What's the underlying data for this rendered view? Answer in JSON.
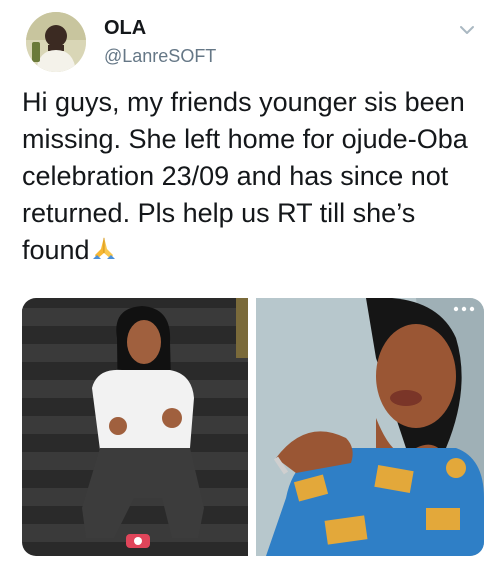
{
  "tweet": {
    "author": {
      "display_name": "OLA",
      "handle": "@LanreSOFT",
      "avatar_icon": "profile-photo"
    },
    "text": "Hi guys, my friends younger sis been missing. She left home for ojude-Oba celebration 23/09 and has since not returned. Pls help us RT till she’s found",
    "emoji": "folded-hands-emoji",
    "caret_icon": "chevron-down-icon",
    "media": [
      {
        "name": "photo-1",
        "description_icon": "photo"
      },
      {
        "name": "photo-2",
        "description_icon": "photo"
      }
    ],
    "media_more_icon": "more-dots-icon",
    "colors": {
      "text": "#14171a",
      "secondary": "#657786",
      "background": "#ffffff"
    }
  }
}
